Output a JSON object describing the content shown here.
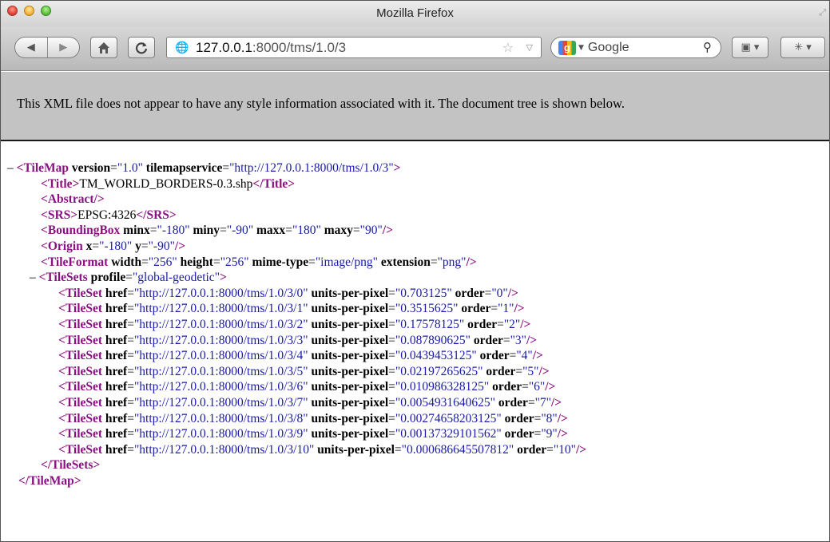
{
  "window": {
    "title": "Mozilla Firefox"
  },
  "toolbar": {
    "back_icon": "back-arrow-icon",
    "forward_icon": "forward-arrow-icon",
    "home_icon": "home-icon",
    "reload_icon": "reload-icon",
    "url_host": "127.0.0.1",
    "url_path": ":8000/tms/1.0/3",
    "search_placeholder": "Google",
    "search_engine_glyph": "g"
  },
  "banner": {
    "text": "This XML file does not appear to have any style information associated with it. The document tree is shown below."
  },
  "xml": {
    "tilemap": {
      "tag": "TileMap",
      "version": "1.0",
      "tilemapservice": "http://127.0.0.1:8000/tms/1.0/3",
      "title": "TM_WORLD_BORDERS-0.3.shp",
      "srs": "EPSG:4326",
      "bbox": {
        "minx": "-180",
        "miny": "-90",
        "maxx": "180",
        "maxy": "90"
      },
      "origin": {
        "x": "-180",
        "y": "-90"
      },
      "tileformat": {
        "width": "256",
        "height": "256",
        "mime": "image/png",
        "extension": "png"
      },
      "tilesets_profile": "global-geodetic"
    },
    "tilesets": [
      {
        "href": "http://127.0.0.1:8000/tms/1.0/3/0",
        "upp": "0.703125",
        "order": "0"
      },
      {
        "href": "http://127.0.0.1:8000/tms/1.0/3/1",
        "upp": "0.3515625",
        "order": "1"
      },
      {
        "href": "http://127.0.0.1:8000/tms/1.0/3/2",
        "upp": "0.17578125",
        "order": "2"
      },
      {
        "href": "http://127.0.0.1:8000/tms/1.0/3/3",
        "upp": "0.087890625",
        "order": "3"
      },
      {
        "href": "http://127.0.0.1:8000/tms/1.0/3/4",
        "upp": "0.0439453125",
        "order": "4"
      },
      {
        "href": "http://127.0.0.1:8000/tms/1.0/3/5",
        "upp": "0.02197265625",
        "order": "5"
      },
      {
        "href": "http://127.0.0.1:8000/tms/1.0/3/6",
        "upp": "0.010986328125",
        "order": "6"
      },
      {
        "href": "http://127.0.0.1:8000/tms/1.0/3/7",
        "upp": "0.0054931640625",
        "order": "7"
      },
      {
        "href": "http://127.0.0.1:8000/tms/1.0/3/8",
        "upp": "0.00274658203125",
        "order": "8"
      },
      {
        "href": "http://127.0.0.1:8000/tms/1.0/3/9",
        "upp": "0.00137329101562",
        "order": "9"
      },
      {
        "href": "http://127.0.0.1:8000/tms/1.0/3/10",
        "upp": "0.000686645507812",
        "order": "10"
      }
    ]
  }
}
